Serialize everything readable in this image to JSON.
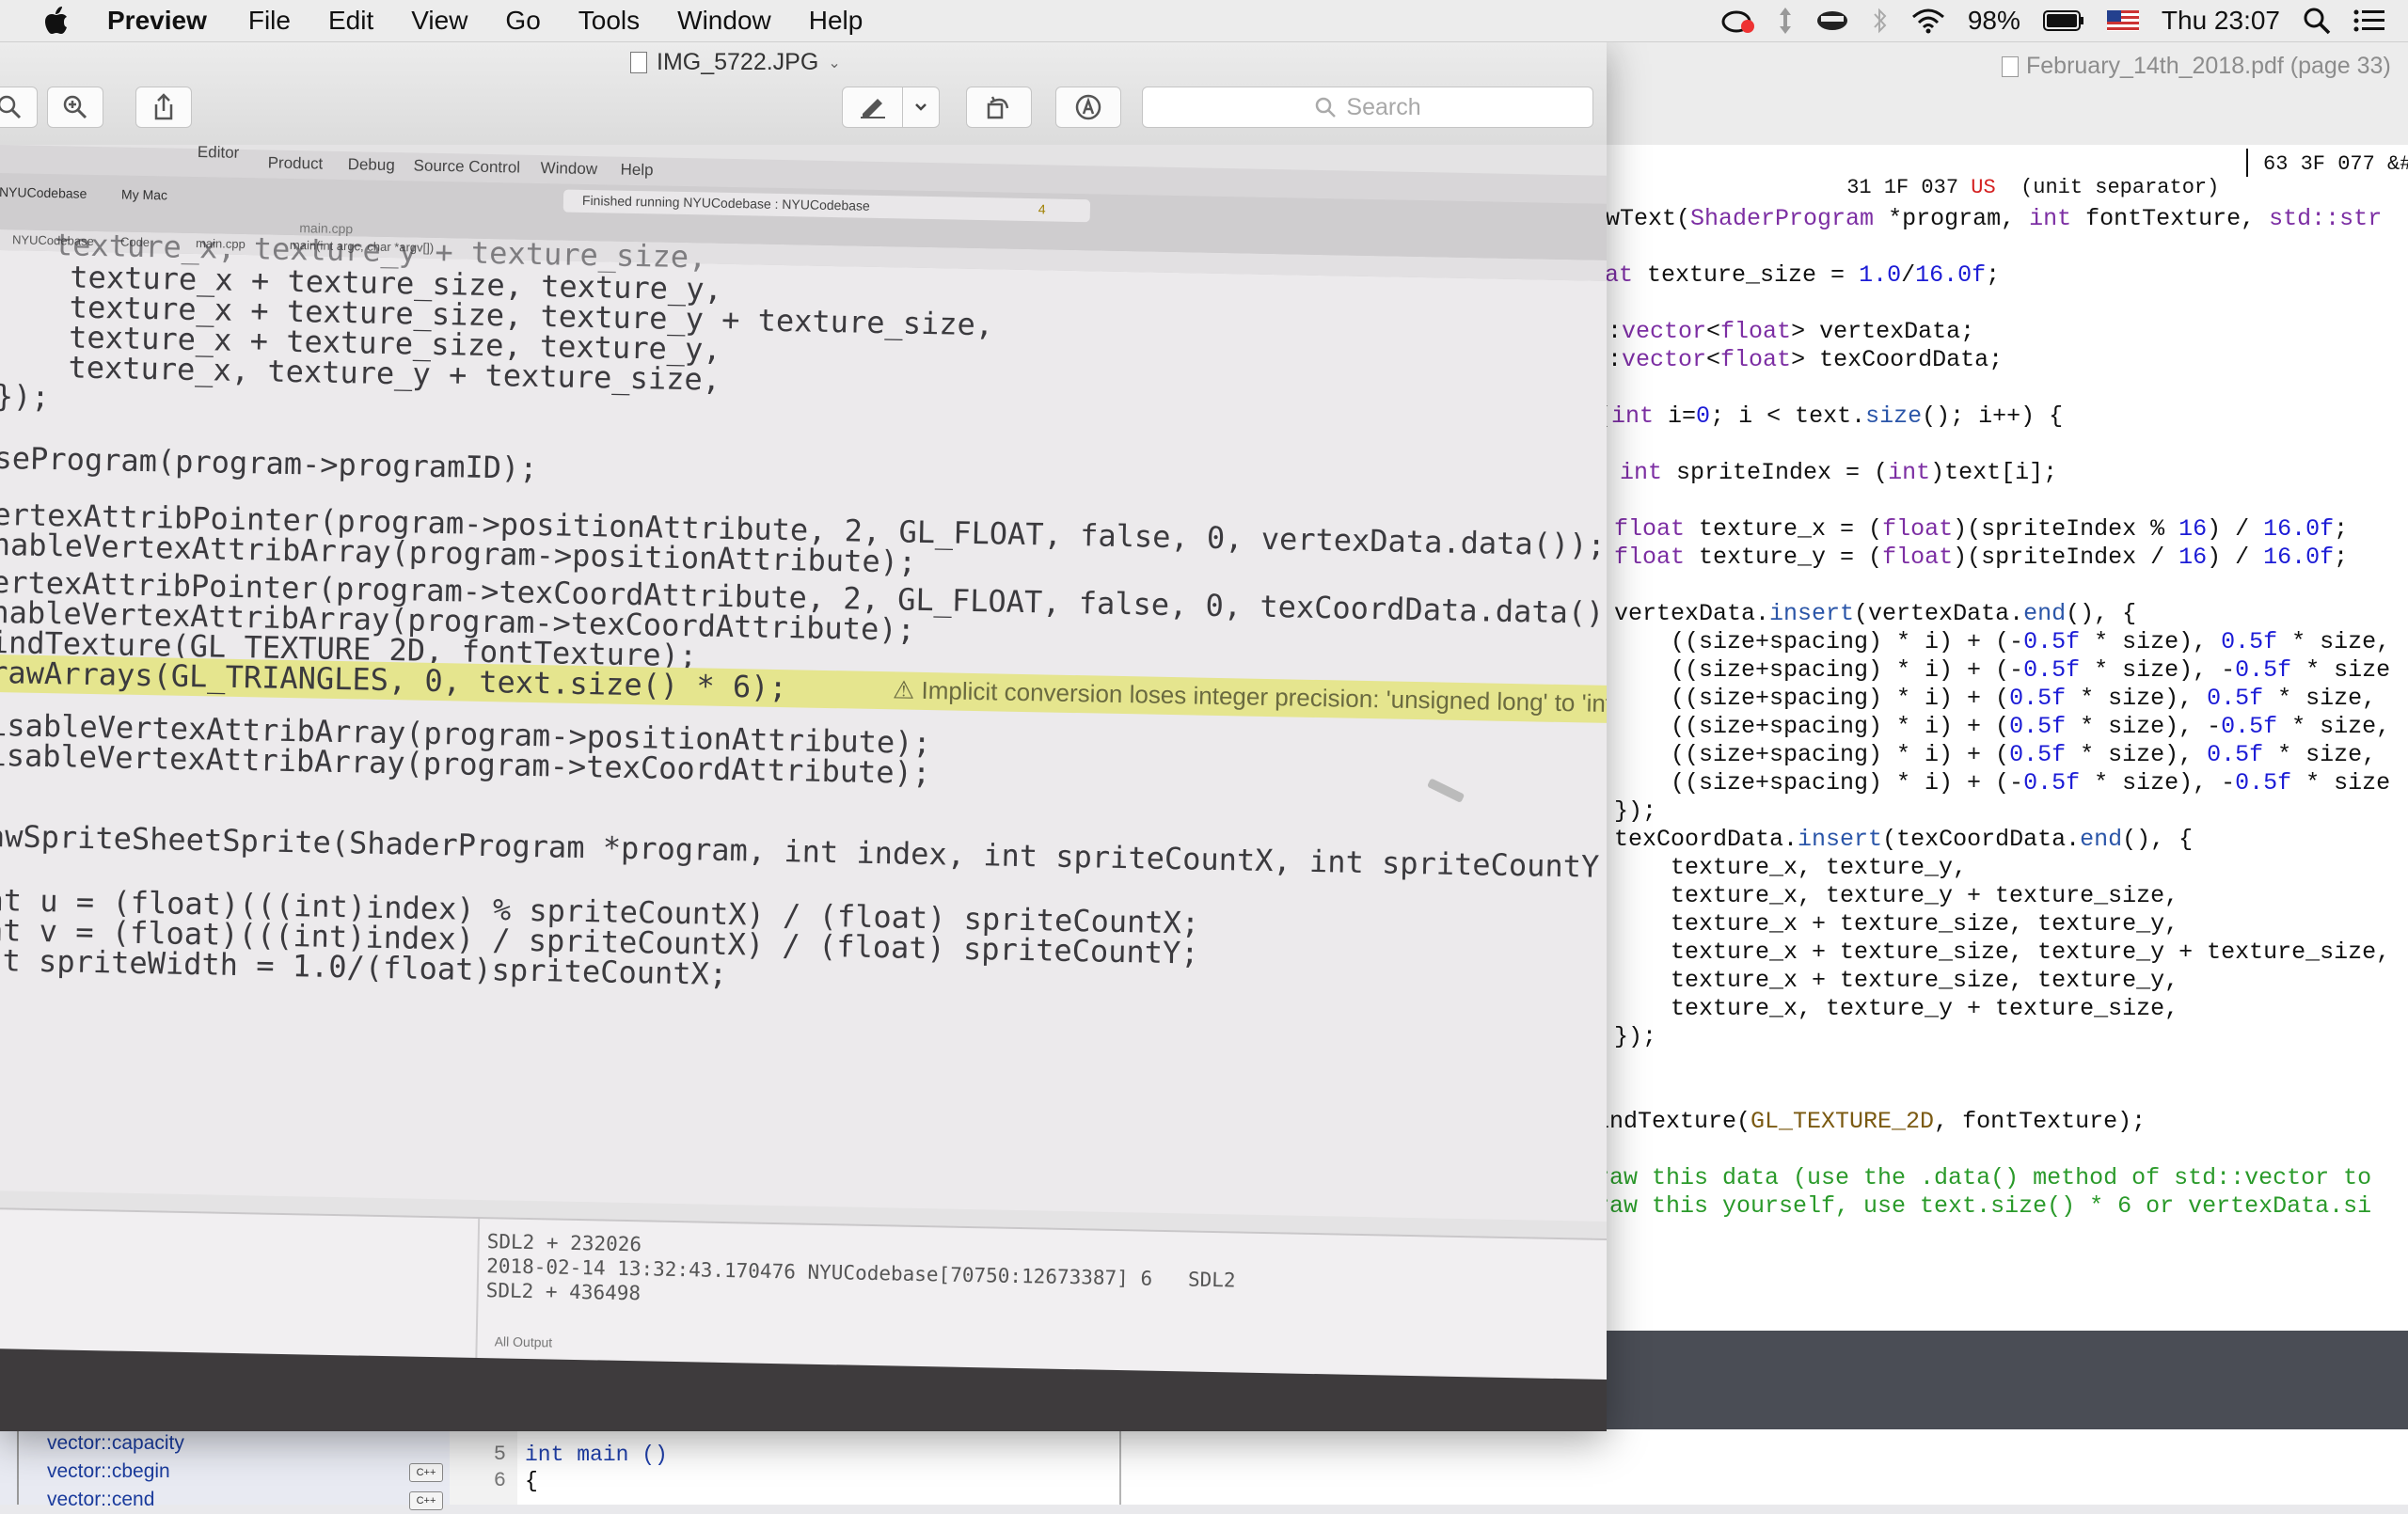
{
  "menubar": {
    "app_name": "Preview",
    "items": [
      "File",
      "Edit",
      "View",
      "Go",
      "Tools",
      "Window",
      "Help"
    ],
    "battery": "98%",
    "clock": "Thu 23:07"
  },
  "preview": {
    "title": "IMG_5722.JPG",
    "search_placeholder": "Search"
  },
  "photo": {
    "xcode_menu": [
      "Product",
      "Debug",
      "Source Control",
      "Window",
      "Help"
    ],
    "xcode_menu_partial": "Editor",
    "scheme": "NYUCodebase",
    "destination": "My Mac",
    "status": "Finished running NYUCodebase : NYUCodebase",
    "tab_title": "main.cpp",
    "jump_bar": [
      "NYUCodebase",
      "Code",
      "main.cpp",
      "main(int argc, char *argv[])"
    ],
    "warning_count": "4",
    "code_lines": [
      "    texture_x + texture_size, texture_y,",
      "    texture_x + texture_size, texture_y + texture_size,",
      "    texture_x + texture_size, texture_y,",
      "    texture_x, texture_y + texture_size,",
      "});",
      "",
      "seProgram(program->programID);",
      "",
      "ertexAttribPointer(program->positionAttribute, 2, GL_FLOAT, false, 0, vertexData.data());",
      "nableVertexAttribArray(program->positionAttribute);",
      "ertexAttribPointer(program->texCoordAttribute, 2, GL_FLOAT, false, 0, texCoordData.data());",
      "nableVertexAttribArray(program->texCoordAttribute);",
      "indTexture(GL_TEXTURE_2D, fontTexture);",
      "rawArrays(GL_TRIANGLES, 0, text.size() * 6);",
      "",
      "isableVertexAttribArray(program->positionAttribute);",
      "isableVertexAttribArray(program->texCoordAttribute);",
      "",
      "",
      "awSpriteSheetSprite(ShaderProgram *program, int index, int spriteCountX, int spriteCountY",
      "",
      "at u = (float)(((int)index) % spriteCountX) / (float) spriteCountX;",
      "at v = (float)(((int)index) / spriteCountX) / (float) spriteCountY;",
      "at spriteWidth = 1.0/(float)spriteCountX;"
    ],
    "warning_text": "Implicit conversion loses integer precision: 'unsigned long' to 'int'",
    "debug_lines": [
      "SDL2 + 232026",
      "2018-02-14 13:32:43.170476 NYUCodebase[70750:12673387] 6   SDL2",
      "SDL2 + 436498"
    ],
    "output_filter": "All Output"
  },
  "pdf": {
    "title": "February_14th_2018.pdf (page 33)",
    "ascii_left": "31 1F 037",
    "ascii_us": "US",
    "ascii_desc": "(unit separator)",
    "ascii_right": "63 3F 077 &#"
  },
  "xcode_bottom": {
    "doc_items": [
      "vector::capacity",
      "vector::cbegin",
      "vector::cend"
    ],
    "line_numbers": [
      "5",
      "6"
    ],
    "code": [
      "int main ()",
      "{"
    ]
  }
}
